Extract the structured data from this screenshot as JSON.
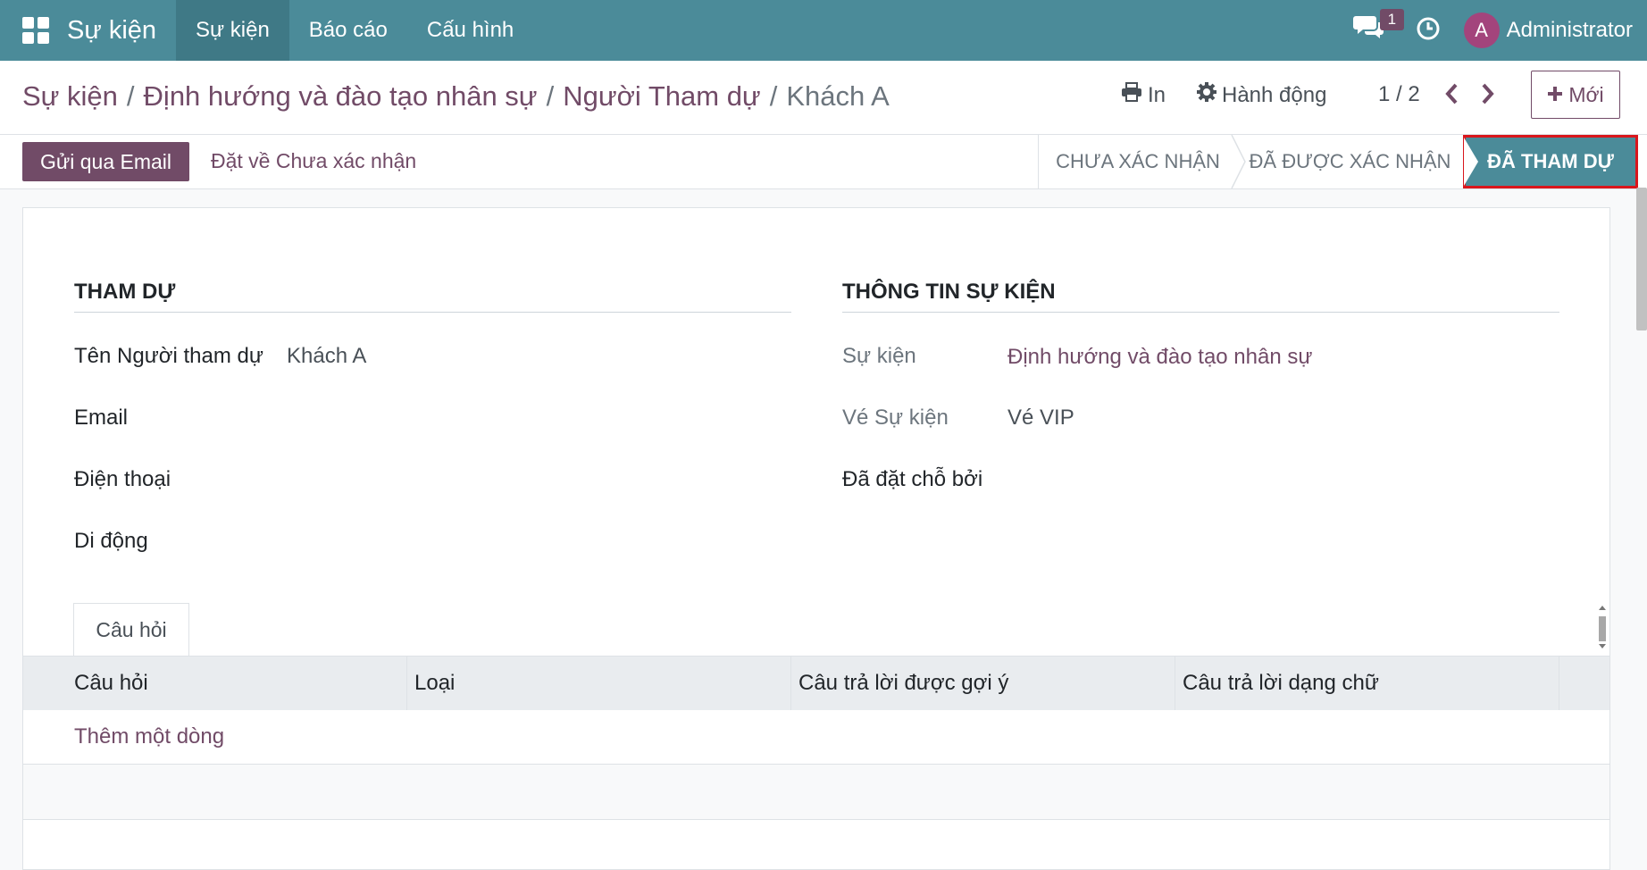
{
  "topbar": {
    "app_name": "Sự kiện",
    "menu": [
      "Sự kiện",
      "Báo cáo",
      "Cấu hình"
    ],
    "chat_badge": "1",
    "avatar_letter": "A",
    "user_name": "Administrator"
  },
  "breadcrumb": {
    "items": [
      "Sự kiện",
      "Định hướng và đào tạo nhân sự",
      "Người Tham dự"
    ],
    "current": "Khách A"
  },
  "actions": {
    "print_label": "In",
    "action_label": "Hành động",
    "pager": "1 / 2",
    "new_label": "Mới"
  },
  "statusbar": {
    "email_button": "Gửi qua Email",
    "reset_button": "Đặt về Chưa xác nhận",
    "stages": [
      "CHƯA XÁC NHẬN",
      "ĐÃ ĐƯỢC XÁC NHẬN",
      "ĐÃ THAM DỰ"
    ],
    "active_stage": "ĐÃ THAM DỰ"
  },
  "form": {
    "attendee_title": "THAM DỰ",
    "event_info_title": "THÔNG TIN SỰ KIỆN",
    "attendee_name_label": "Tên Người tham dự",
    "attendee_name_value": "Khách A",
    "email_label": "Email",
    "phone_label": "Điện thoại",
    "mobile_label": "Di động",
    "event_label": "Sự kiện",
    "event_value": "Định hướng và đào tạo nhân sự",
    "ticket_label": "Vé Sự kiện",
    "ticket_value": "Vé VIP",
    "booked_by_label": "Đã đặt chỗ bởi"
  },
  "questions": {
    "tab_label": "Câu hỏi",
    "columns": [
      "Câu hỏi",
      "Loại",
      "Câu trả lời được gợi ý",
      "Câu trả lời dạng chữ"
    ],
    "add_line": "Thêm một dòng"
  },
  "colors": {
    "primary": "#714b67",
    "navbar": "#4b8b99",
    "highlight": "#d9161c"
  }
}
